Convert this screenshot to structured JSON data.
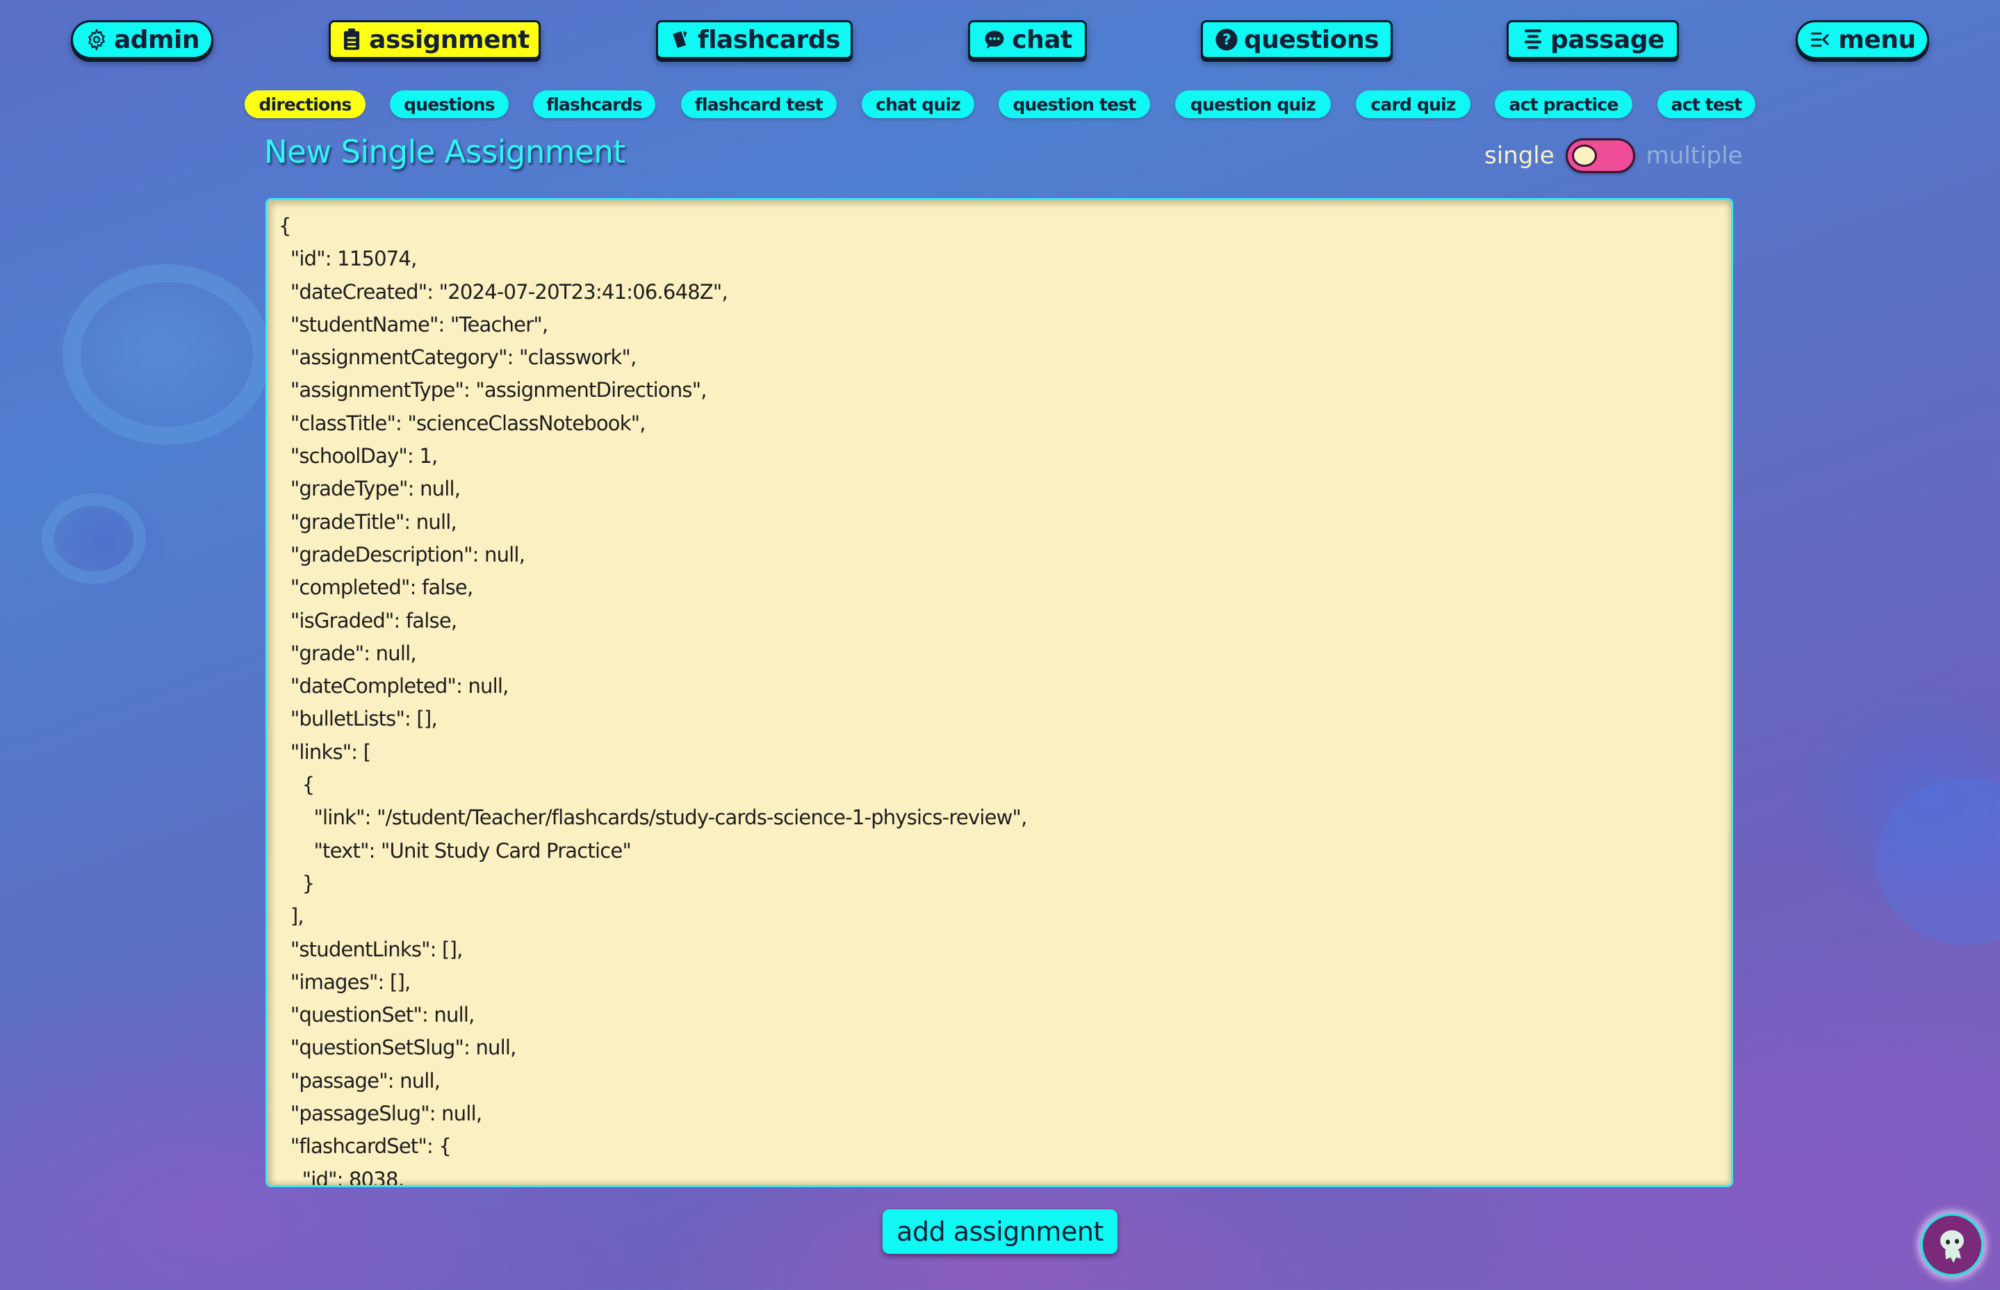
{
  "topnav": [
    {
      "label": "admin",
      "icon": "gear-icon",
      "active": false
    },
    {
      "label": "assignment",
      "icon": "clipboard-icon",
      "active": true
    },
    {
      "label": "flashcards",
      "icon": "cards-icon",
      "active": false
    },
    {
      "label": "chat",
      "icon": "chat-bubble-icon",
      "active": false
    },
    {
      "label": "questions",
      "icon": "question-circle-icon",
      "active": false
    },
    {
      "label": "passage",
      "icon": "text-lines-icon",
      "active": false
    },
    {
      "label": "menu",
      "icon": "menu-collapse-icon",
      "active": false
    }
  ],
  "subnav": [
    {
      "label": "directions",
      "active": true
    },
    {
      "label": "questions",
      "active": false
    },
    {
      "label": "flashcards",
      "active": false
    },
    {
      "label": "flashcard test",
      "active": false
    },
    {
      "label": "chat quiz",
      "active": false
    },
    {
      "label": "question test",
      "active": false
    },
    {
      "label": "question quiz",
      "active": false
    },
    {
      "label": "card quiz",
      "active": false
    },
    {
      "label": "act practice",
      "active": false
    },
    {
      "label": "act test",
      "active": false
    }
  ],
  "page": {
    "title": "New Single Assignment"
  },
  "mode_toggle": {
    "left_label": "single",
    "right_label": "multiple",
    "selected": "single"
  },
  "editor": {
    "value": "{\n  \"id\": 115074,\n  \"dateCreated\": \"2024-07-20T23:41:06.648Z\",\n  \"studentName\": \"Teacher\",\n  \"assignmentCategory\": \"classwork\",\n  \"assignmentType\": \"assignmentDirections\",\n  \"classTitle\": \"scienceClassNotebook\",\n  \"schoolDay\": 1,\n  \"gradeType\": null,\n  \"gradeTitle\": null,\n  \"gradeDescription\": null,\n  \"completed\": false,\n  \"isGraded\": false,\n  \"grade\": null,\n  \"dateCompleted\": null,\n  \"bulletLists\": [],\n  \"links\": [\n    {\n      \"link\": \"/student/Teacher/flashcards/study-cards-science-1-physics-review\",\n      \"text\": \"Unit Study Card Practice\"\n    }\n  ],\n  \"studentLinks\": [],\n  \"images\": [],\n  \"questionSet\": null,\n  \"questionSetSlug\": null,\n  \"passage\": null,\n  \"passageSlug\": null,\n  \"flashcardSet\": {\n    \"id\": 8038,"
  },
  "actions": {
    "add_label": "add assignment"
  },
  "avatar": {
    "icon": "ghost-avatar-icon"
  },
  "colors": {
    "accent_cyan": "#0ff8f4",
    "active_yellow": "#ffff14",
    "toggle_pink": "#ef4d98",
    "editor_bg": "#fbf0c2",
    "title_cyan": "#2ff6f2"
  }
}
